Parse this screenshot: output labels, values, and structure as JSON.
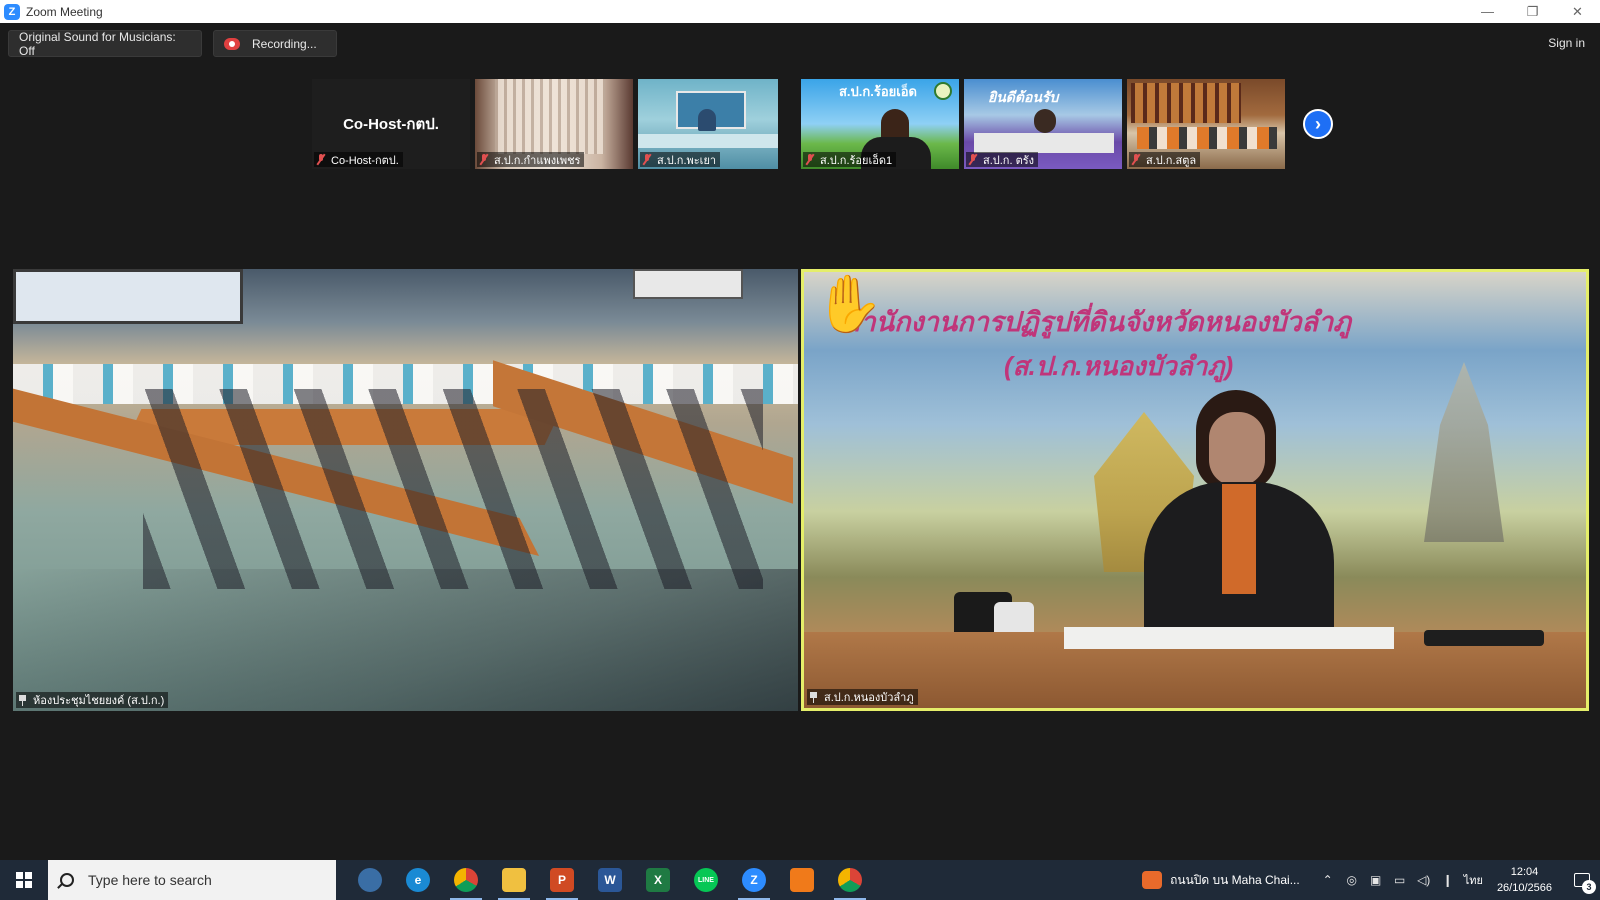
{
  "window": {
    "title": "Zoom Meeting",
    "controls": {
      "minimize": "—",
      "restore": "❐",
      "close": "✕"
    }
  },
  "toolbar": {
    "original_sound": "Original Sound for Musicians: Off",
    "recording": "Recording...",
    "sign_in": "Sign in"
  },
  "thumbnails": {
    "cohost_center": "Co-Host-กตป.",
    "items": [
      {
        "name": "Co-Host-กตป.",
        "muted": true
      },
      {
        "name": "ส.ป.ก.กำแพงเพชร",
        "muted": true
      },
      {
        "name": "ส.ป.ก.พะเยา",
        "muted": true
      },
      {
        "name": "ส.ป.ก.ร้อยเอ็ด1",
        "muted": true,
        "banner": "ส.ป.ก.ร้อยเอ็ด"
      },
      {
        "name": "ส.ป.ก. ตรัง",
        "muted": true,
        "banner": "ยินดีต้อนรับ"
      },
      {
        "name": "ส.ป.ก.สตูล",
        "muted": true
      }
    ],
    "next_icon": "›"
  },
  "tiles": {
    "left": {
      "name": "ห้องประชุมไชยยงค์ (ส.ป.ก.)",
      "pinned": true
    },
    "right": {
      "name": "ส.ป.ก.หนองบัวลำภู",
      "pinned": true,
      "hand_raised": true,
      "banner_line1": "สำนักงานการปฏิรูปที่ดินจังหวัดหนองบัวลำภู",
      "banner_line2": "(ส.ป.ก.หนองบัวลำภู)"
    }
  },
  "taskbar": {
    "search_placeholder": "Type here to search",
    "apps": [
      {
        "name": "cortana",
        "label": "",
        "color": "#3a6ea5"
      },
      {
        "name": "edge",
        "label": "e",
        "color": "#1a8ad4"
      },
      {
        "name": "chrome",
        "label": "",
        "color": "#e3c23a"
      },
      {
        "name": "file-explorer",
        "label": "",
        "color": "#f0c040"
      },
      {
        "name": "powerpoint",
        "label": "P",
        "color": "#d04a23"
      },
      {
        "name": "word",
        "label": "W",
        "color": "#2b5797"
      },
      {
        "name": "excel",
        "label": "X",
        "color": "#1f7a43"
      },
      {
        "name": "line",
        "label": "LINE",
        "color": "#06c755"
      },
      {
        "name": "zoom",
        "label": "Z",
        "color": "#2d8cff"
      },
      {
        "name": "app-orange",
        "label": "",
        "color": "#f07a1a"
      },
      {
        "name": "chrome-2",
        "label": "",
        "color": "#e3c23a"
      }
    ],
    "news": "ถนนปิด บน Maha Chai...",
    "language": "ไทย",
    "time": "12:04",
    "date": "26/10/2566",
    "notification_count": "3"
  }
}
